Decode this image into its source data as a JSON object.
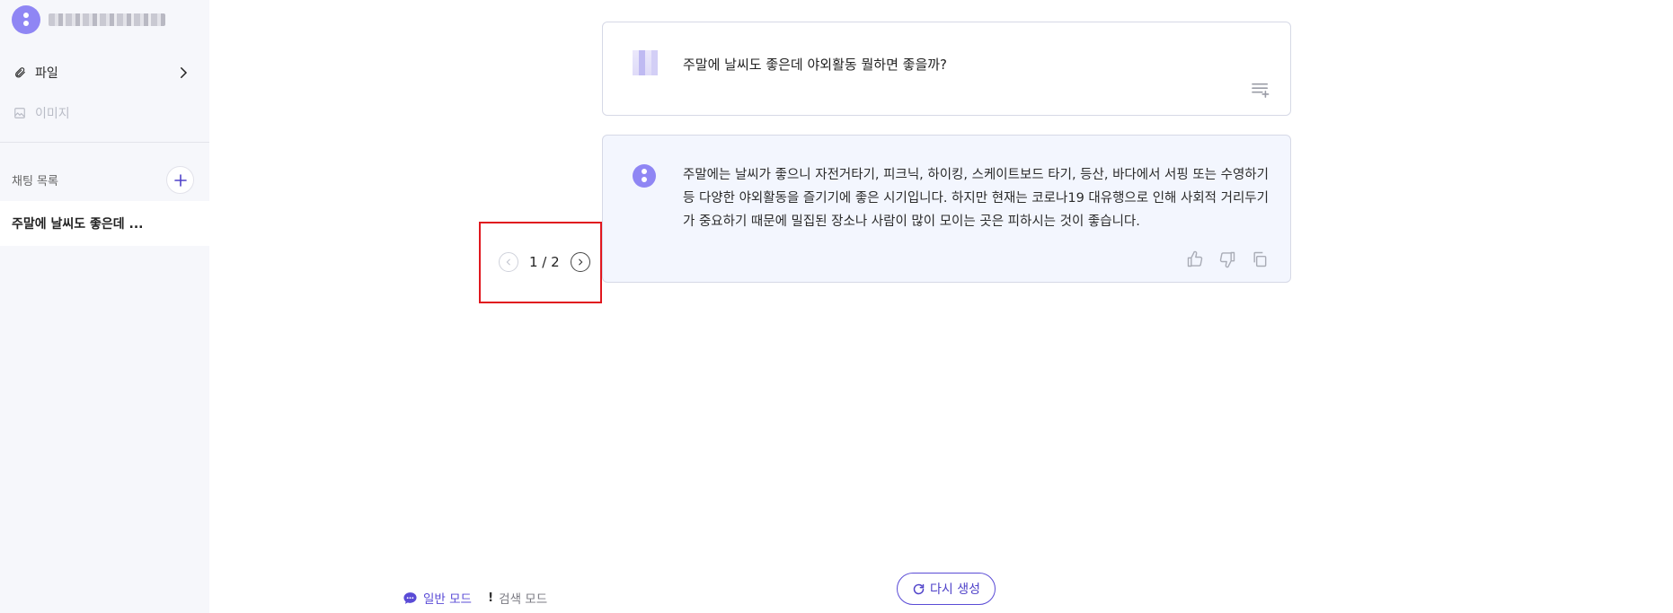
{
  "sidebar": {
    "menu": [
      {
        "label": "파일",
        "icon": "paperclip-icon"
      },
      {
        "label": "이미지",
        "icon": "image-icon"
      }
    ],
    "chat_list_title": "채팅 목록",
    "chats": [
      {
        "title": "주말에 날씨도 좋은데 ..."
      }
    ]
  },
  "conversation": {
    "question": "주말에 날씨도 좋은데 야외활동 뭘하면 좋을까?",
    "answer": "주말에는 날씨가 좋으니 자전거타기, 피크닉, 하이킹, 스케이트보드 타기, 등산, 바다에서 서핑 또는 수영하기 등 다양한 야외활동을 즐기기에 좋은 시기입니다. 하지만 현재는 코로나19 대유행으로 인해 사회적 거리두기가 중요하기 때문에 밀집된 장소나 사람이 많이 모이는 곳은 피하시는 것이 좋습니다.",
    "pager": "1 / 2"
  },
  "footer": {
    "mode_general": "일반 모드",
    "mode_search": "검색 모드",
    "regenerate": "다시 생성"
  },
  "colors": {
    "accent": "#5a4bd6",
    "highlight": "#e0171e",
    "answer_bg": "#f3f6fe",
    "sidebar_bg": "#f6f7fb"
  }
}
